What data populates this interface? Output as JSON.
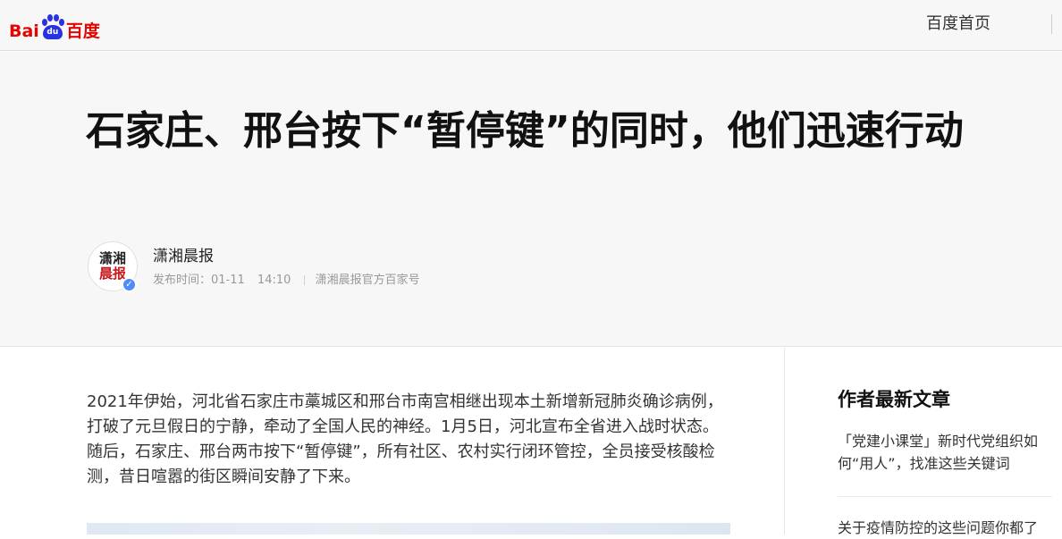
{
  "header": {
    "logo_prefix": "Bai",
    "logo_paw": "du",
    "logo_suffix": "百度",
    "home_link": "百度首页"
  },
  "article": {
    "title": "石家庄、邢台按下“暂停键”的同时，他们迅速行动",
    "author": {
      "name": "潇湘晨报",
      "avatar_line1": "潇湘",
      "avatar_line2": "晨报",
      "verified_icon": "✓"
    },
    "meta": {
      "publish_label": "发布时间：01-11",
      "publish_time": "14:10",
      "source": "潇湘晨报官方百家号"
    },
    "paragraph": "2021年伊始，河北省石家庄市藁城区和邢台市南宫相继出现本土新增新冠肺炎确诊病例，打破了元旦假日的宁静，牵动了全国人民的神经。1月5日，河北宣布全省进入战时状态。随后，石家庄、邢台两市按下“暂停键”，所有社区、农村实行闭环管控，全员接受核酸检测，昔日喧嚣的街区瞬间安静了下来。"
  },
  "sidebar": {
    "title": "作者最新文章",
    "items": [
      "「党建小课堂」新时代党组织如何“用人”，找准这些关键词",
      "关于疫情防控的这些问题你都了"
    ]
  }
}
